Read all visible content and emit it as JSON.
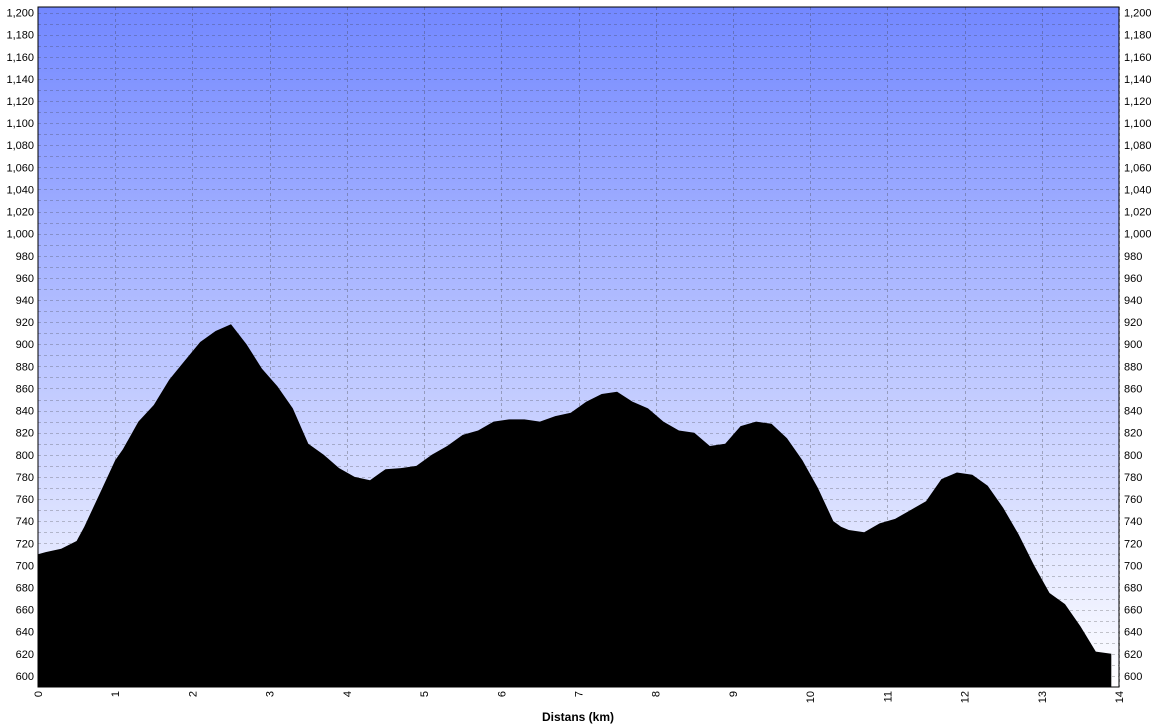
{
  "chart_data": {
    "type": "area",
    "title": "",
    "xlabel": "Distans (km)",
    "ylabel": "",
    "xlim": [
      0,
      14
    ],
    "ylim": [
      590,
      1205
    ],
    "x_ticks": [
      0,
      1,
      2,
      3,
      4,
      5,
      6,
      7,
      8,
      9,
      10,
      11,
      12,
      13,
      14
    ],
    "y_ticks": [
      600,
      620,
      640,
      660,
      680,
      700,
      720,
      740,
      760,
      780,
      800,
      820,
      840,
      860,
      880,
      900,
      920,
      940,
      960,
      980,
      1000,
      1020,
      1040,
      1060,
      1080,
      1100,
      1120,
      1140,
      1160,
      1180,
      1200
    ],
    "y_tick_labels": [
      "600",
      "620",
      "640",
      "660",
      "680",
      "700",
      "720",
      "740",
      "760",
      "780",
      "800",
      "820",
      "840",
      "860",
      "880",
      "900",
      "920",
      "940",
      "960",
      "980",
      "1,000",
      "1,020",
      "1,040",
      "1,060",
      "1,080",
      "1,100",
      "1,120",
      "1,140",
      "1,160",
      "1,180",
      "1,200"
    ],
    "grid": true,
    "background": {
      "gradient_top": "#7388ff",
      "gradient_bottom": "#ffffff"
    },
    "fill_color": "#000000",
    "series": [
      {
        "x": [
          0,
          0.1,
          0.3,
          0.5,
          0.6,
          0.8,
          1.0,
          1.1,
          1.3,
          1.5,
          1.7,
          1.9,
          2.1,
          2.3,
          2.5,
          2.7,
          2.9,
          3.1,
          3.3,
          3.5,
          3.7,
          3.9,
          4.1,
          4.3,
          4.5,
          4.7,
          4.9,
          5.1,
          5.3,
          5.5,
          5.7,
          5.9,
          6.1,
          6.3,
          6.5,
          6.7,
          6.9,
          7.1,
          7.3,
          7.5,
          7.7,
          7.9,
          8.1,
          8.3,
          8.5,
          8.7,
          8.9,
          9.1,
          9.3,
          9.5,
          9.7,
          9.9,
          10.1,
          10.3,
          10.4,
          10.5,
          10.7,
          10.9,
          11.1,
          11.3,
          11.5,
          11.7,
          11.9,
          12.1,
          12.3,
          12.5,
          12.7,
          12.9,
          13.1,
          13.3,
          13.5,
          13.7,
          13.9
        ],
        "y": [
          710,
          712,
          715,
          722,
          735,
          765,
          795,
          805,
          830,
          845,
          868,
          885,
          902,
          912,
          918,
          900,
          878,
          862,
          842,
          810,
          800,
          788,
          780,
          777,
          787,
          788,
          790,
          800,
          808,
          818,
          822,
          830,
          832,
          832,
          830,
          835,
          838,
          848,
          855,
          857,
          848,
          842,
          830,
          822,
          820,
          808,
          810,
          826,
          830,
          828,
          815,
          795,
          770,
          740,
          735,
          732,
          730,
          738,
          742,
          750,
          758,
          778,
          784,
          782,
          772,
          752,
          728,
          700,
          675,
          665,
          645,
          622,
          620
        ]
      }
    ]
  }
}
